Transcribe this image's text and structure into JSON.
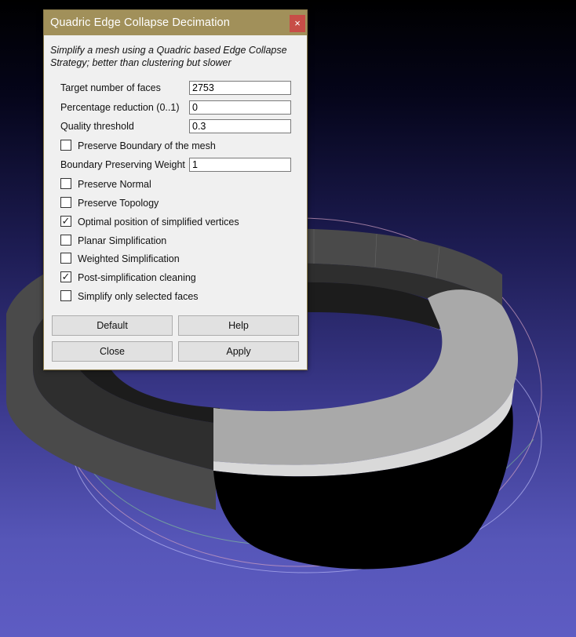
{
  "dialog": {
    "title": "Quadric Edge Collapse Decimation",
    "close_glyph": "×",
    "description": "Simplify a mesh using a Quadric based Edge Collapse Strategy; better than clustering but slower",
    "fields": [
      {
        "label": "Target number of faces",
        "value": "2753"
      },
      {
        "label": "Percentage reduction (0..1)",
        "value": "0"
      },
      {
        "label": "Quality threshold",
        "value": "0.3"
      }
    ],
    "checkbox_boundary": {
      "label": "Preserve Boundary of the mesh",
      "checked": false
    },
    "boundary_weight": {
      "label": "Boundary Preserving Weight",
      "value": "1"
    },
    "checkboxes": [
      {
        "label": "Preserve Normal",
        "checked": false
      },
      {
        "label": "Preserve Topology",
        "checked": false
      },
      {
        "label": "Optimal position of simplified vertices",
        "checked": true
      },
      {
        "label": "Planar Simplification",
        "checked": false
      },
      {
        "label": "Weighted Simplification",
        "checked": false
      },
      {
        "label": "Post-simplification cleaning",
        "checked": true
      },
      {
        "label": "Simplify only selected faces",
        "checked": false
      }
    ],
    "buttons": {
      "default_label": "Default",
      "help_label": "Help",
      "close_label": "Close",
      "apply_label": "Apply"
    }
  },
  "viewport": {
    "background_top": "#000000",
    "background_bottom": "#5e5cc3",
    "mesh_dark": "#3a3a3a",
    "mesh_selected": "#c0c0c0"
  },
  "check_glyph": "✓"
}
